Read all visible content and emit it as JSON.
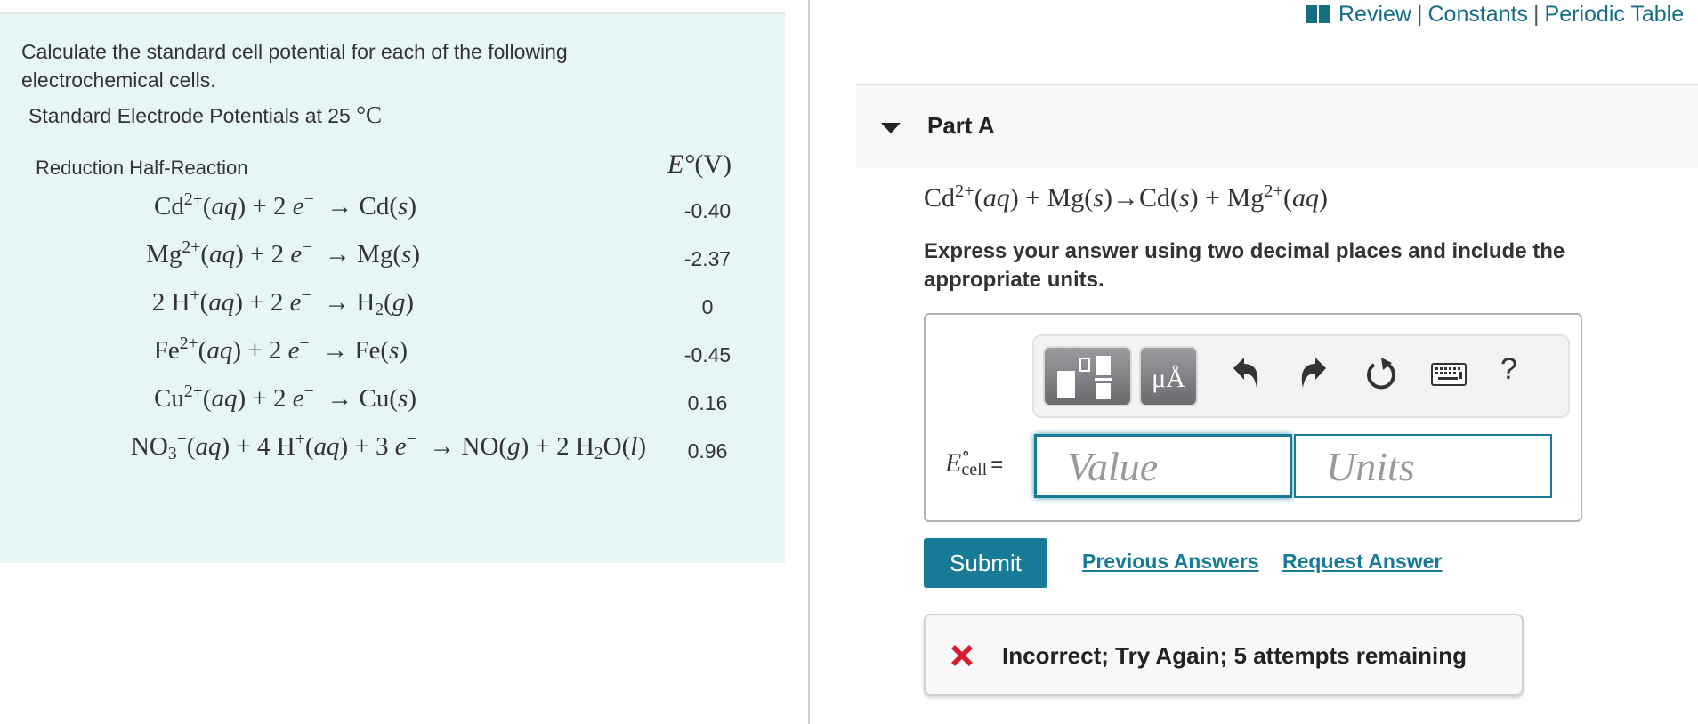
{
  "intro": {
    "text": "Calculate the standard cell potential for each of the following electrochemical cells."
  },
  "table": {
    "title_prefix": "Standard Electrode Potentials at 25",
    "title_unit": "°C",
    "col_reaction": "Reduction Half-Reaction",
    "col_potential_symbol": "E°",
    "col_potential_unit": "(V)",
    "rows": [
      {
        "reaction": "Cd²⁺(aq) + 2 e⁻ → Cd(s)",
        "potential": "-0.40"
      },
      {
        "reaction": "Mg²⁺(aq) + 2 e⁻ → Mg(s)",
        "potential": "-2.37"
      },
      {
        "reaction": "2 H⁺(aq) + 2 e⁻ → H₂(g)",
        "potential": "0"
      },
      {
        "reaction": "Fe²⁺(aq) + 2 e⁻ → Fe(s)",
        "potential": "-0.45"
      },
      {
        "reaction": "Cu²⁺(aq) + 2 e⁻ → Cu(s)",
        "potential": "0.16"
      },
      {
        "reaction": "NO₃⁻(aq) + 4 H⁺(aq) + 3 e⁻ → NO(g) + 2 H₂O(l)",
        "potential": "0.96"
      }
    ]
  },
  "header_links": {
    "icon": "book-icon",
    "items": [
      "Review",
      "Constants",
      "Periodic Table"
    ],
    "separator": "|"
  },
  "part": {
    "title": "Part A",
    "question_equation": "Cd²⁺(aq) + Mg(s) → Cd(s) + Mg²⁺(aq)",
    "instructions": "Express your answer using two decimal places and include the appropriate units."
  },
  "toolbar": {
    "buttons": [
      "templates-icon",
      "units-icon",
      "undo-icon",
      "redo-icon",
      "reset-icon",
      "keyboard-icon",
      "help-icon"
    ],
    "units_label": "μÅ",
    "help_label": "?"
  },
  "answer": {
    "label_symbol": "E",
    "label_superscript": "∘",
    "label_subscript": "cell",
    "label_equals": "=",
    "value": "",
    "value_placeholder": "Value",
    "units": "",
    "units_placeholder": "Units"
  },
  "actions": {
    "submit_label": "Submit",
    "previous_answers_label": "Previous Answers",
    "request_answer_label": "Request Answer"
  },
  "feedback": {
    "status": "incorrect",
    "icon": "x-icon",
    "text": "Incorrect; Try Again; 5 attempts remaining",
    "icon_color": "#d9192e"
  },
  "colors": {
    "accent": "#177b98",
    "left_panel_bg": "#e6f6f6",
    "link": "#156e85"
  }
}
